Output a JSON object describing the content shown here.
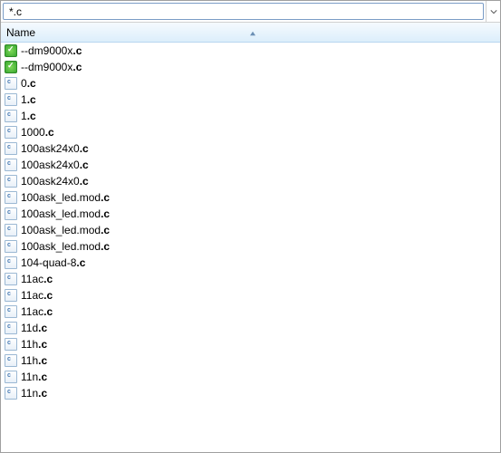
{
  "search": {
    "value": "*.c"
  },
  "header": {
    "name_label": "Name"
  },
  "files": [
    {
      "prefix": "--dm9000x",
      "ext": ".c",
      "checked": true
    },
    {
      "prefix": "--dm9000x",
      "ext": ".c",
      "checked": true
    },
    {
      "prefix": "0",
      "ext": ".c",
      "checked": false
    },
    {
      "prefix": "1",
      "ext": ".c",
      "checked": false
    },
    {
      "prefix": "1",
      "ext": ".c",
      "checked": false
    },
    {
      "prefix": "1000",
      "ext": ".c",
      "checked": false
    },
    {
      "prefix": "100ask24x0",
      "ext": ".c",
      "checked": false
    },
    {
      "prefix": "100ask24x0",
      "ext": ".c",
      "checked": false
    },
    {
      "prefix": "100ask24x0",
      "ext": ".c",
      "checked": false
    },
    {
      "prefix": "100ask_led.mod",
      "ext": ".c",
      "checked": false
    },
    {
      "prefix": "100ask_led.mod",
      "ext": ".c",
      "checked": false
    },
    {
      "prefix": "100ask_led.mod",
      "ext": ".c",
      "checked": false
    },
    {
      "prefix": "100ask_led.mod",
      "ext": ".c",
      "checked": false
    },
    {
      "prefix": "104-quad-8",
      "ext": ".c",
      "checked": false
    },
    {
      "prefix": "11ac",
      "ext": ".c",
      "checked": false
    },
    {
      "prefix": "11ac",
      "ext": ".c",
      "checked": false
    },
    {
      "prefix": "11ac",
      "ext": ".c",
      "checked": false
    },
    {
      "prefix": "11d",
      "ext": ".c",
      "checked": false
    },
    {
      "prefix": "11h",
      "ext": ".c",
      "checked": false
    },
    {
      "prefix": "11h",
      "ext": ".c",
      "checked": false
    },
    {
      "prefix": "11n",
      "ext": ".c",
      "checked": false
    },
    {
      "prefix": "11n",
      "ext": ".c",
      "checked": false
    }
  ]
}
